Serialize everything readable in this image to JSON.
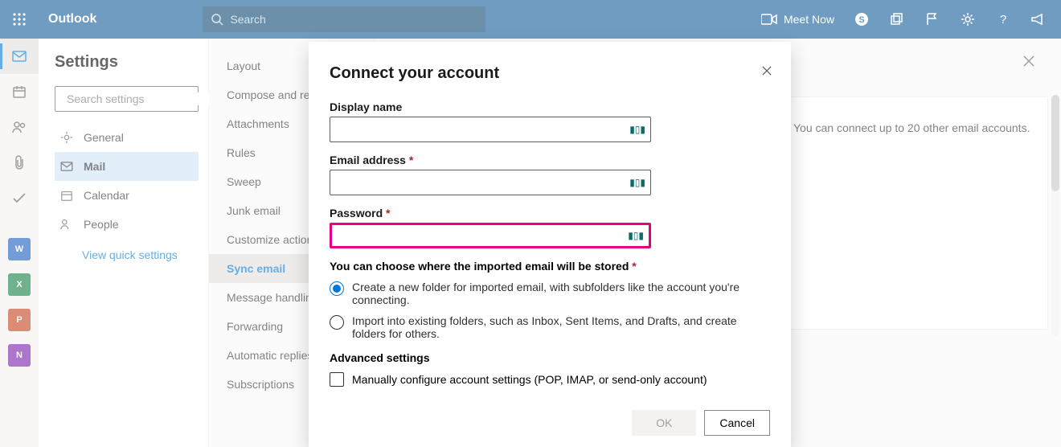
{
  "topbar": {
    "brand": "Outlook",
    "search_placeholder": "Search",
    "meet_now": "Meet Now"
  },
  "settings": {
    "title": "Settings",
    "search_placeholder": "Search settings",
    "categories": [
      {
        "icon": "gear",
        "label": "General"
      },
      {
        "icon": "mail",
        "label": "Mail"
      },
      {
        "icon": "calendar",
        "label": "Calendar"
      },
      {
        "icon": "people",
        "label": "People"
      }
    ],
    "active_category_index": 1,
    "quick_link": "View quick settings",
    "options": [
      "Layout",
      "Compose and reply",
      "Attachments",
      "Rules",
      "Sweep",
      "Junk email",
      "Customize actions",
      "Sync email",
      "Message handling",
      "Forwarding",
      "Automatic replies",
      "Subscriptions"
    ],
    "active_option_index": 7
  },
  "content_behind": "You can connect up to 20 other email accounts.",
  "modal": {
    "title": "Connect your account",
    "fields": {
      "display_name_label": "Display name",
      "display_name_value": "",
      "email_label": "Email address",
      "email_value": "",
      "password_label": "Password",
      "password_value": ""
    },
    "store_header": "You can choose where the imported email will be stored",
    "radios": [
      "Create a new folder for imported email, with subfolders like the account you're connecting.",
      "Import into existing folders, such as Inbox, Sent Items, and Drafts, and create folders for others."
    ],
    "radio_selected_index": 0,
    "advanced_header": "Advanced settings",
    "manual_checkbox_label": "Manually configure account settings (POP, IMAP, or send-only account)",
    "manual_checked": false,
    "ok_label": "OK",
    "cancel_label": "Cancel"
  },
  "leftrail_apps": [
    {
      "name": "Word",
      "bg": "#185abd",
      "letter": "W"
    },
    {
      "name": "Excel",
      "bg": "#107c41",
      "letter": "X"
    },
    {
      "name": "PowerPoint",
      "bg": "#c43e1c",
      "letter": "P"
    },
    {
      "name": "OneNote",
      "bg": "#7719aa",
      "letter": "N"
    }
  ]
}
